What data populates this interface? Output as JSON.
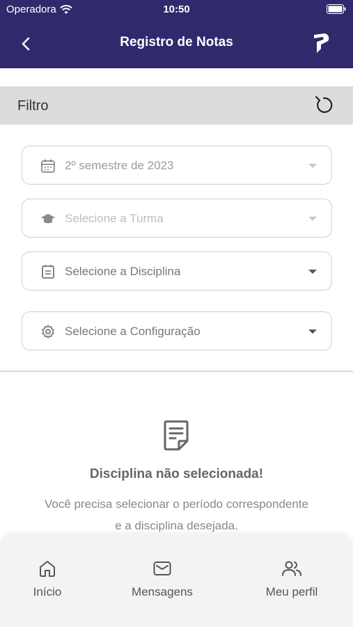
{
  "status_bar": {
    "carrier": "Operadora",
    "time": "10:50"
  },
  "header": {
    "title": "Registro de Notas",
    "back_icon": "chevron-left-icon",
    "logo_icon": "app-logo"
  },
  "filter": {
    "title": "Filtro",
    "reset_icon": "reset-icon"
  },
  "selects": {
    "period": {
      "value": "2º semestre de 2023",
      "icon": "calendar-icon"
    },
    "class": {
      "placeholder": "Selecione a Turma",
      "icon": "graduation-cap-icon"
    },
    "subject": {
      "placeholder": "Selecione a Disciplina",
      "icon": "notebook-icon"
    },
    "configuration": {
      "placeholder": "Selecione a Configuração",
      "icon": "gear-icon"
    }
  },
  "empty_state": {
    "title": "Disciplina não selecionada!",
    "message": "Você precisa selecionar o período correspondente e a disciplina desejada."
  },
  "bottom_nav": {
    "items": [
      {
        "label": "Início",
        "icon": "home-icon"
      },
      {
        "label": "Mensagens",
        "icon": "mail-icon"
      },
      {
        "label": "Meu perfil",
        "icon": "users-icon"
      }
    ]
  },
  "colors": {
    "header_bg": "#2f2a6b",
    "filter_bg": "#dcdcdc",
    "nav_bg": "#f3f3f3"
  }
}
